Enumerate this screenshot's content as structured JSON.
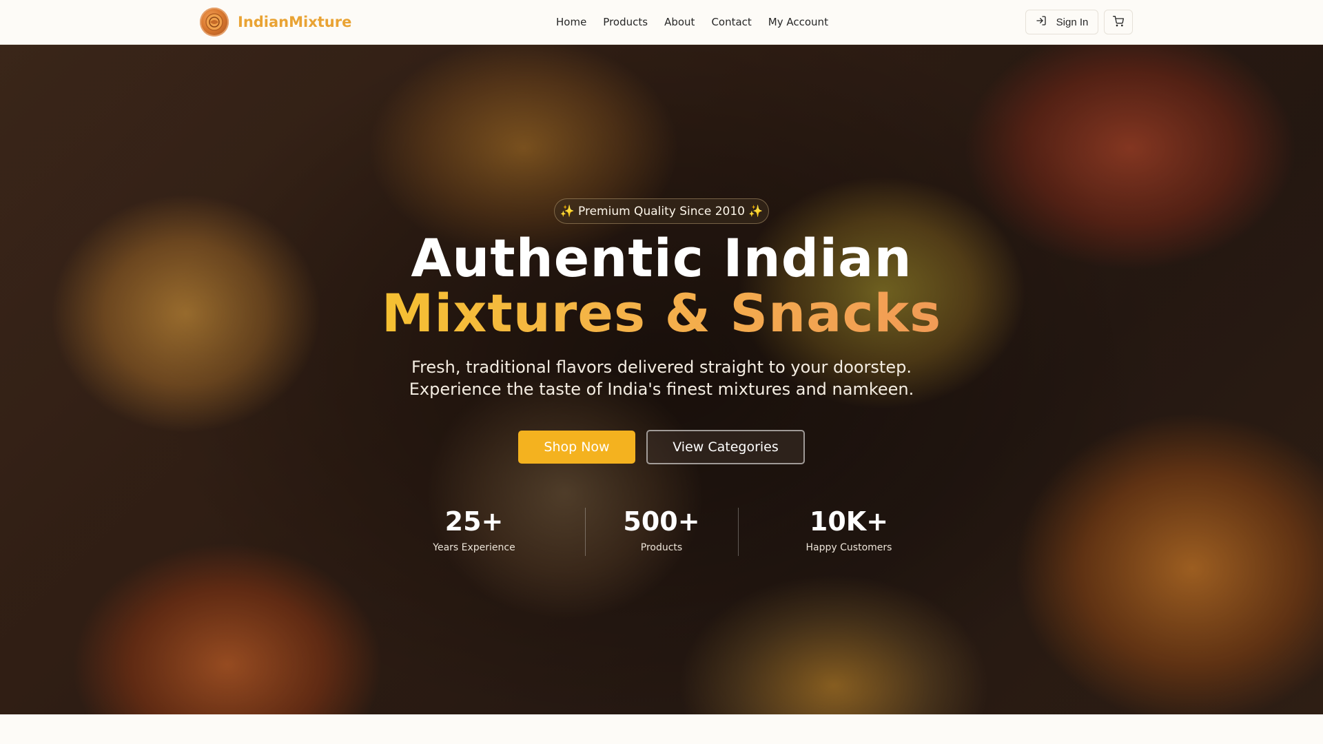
{
  "brand": {
    "name": "IndianMixture",
    "color": "#e9a334"
  },
  "nav": {
    "items": [
      "Home",
      "Products",
      "About",
      "Contact",
      "My Account"
    ]
  },
  "header_actions": {
    "signin_label": "Sign In",
    "signin_icon": "log-in-icon",
    "cart_icon": "shopping-cart-icon"
  },
  "hero": {
    "badge": "✨ Premium Quality Since 2010 ✨",
    "title_line1": "Authentic Indian",
    "title_line2": "Mixtures & Snacks",
    "subtitle_line1": "Fresh, traditional flavors delivered straight to your doorstep.",
    "subtitle_line2": "Experience the taste of India's finest mixtures and namkeen.",
    "primary_button": "Shop Now",
    "secondary_button": "View Categories",
    "accent_color": "#f4b21f",
    "stats": [
      {
        "value": "25+",
        "label": "Years Experience"
      },
      {
        "value": "500+",
        "label": "Products"
      },
      {
        "value": "10K+",
        "label": "Happy Customers"
      }
    ]
  }
}
